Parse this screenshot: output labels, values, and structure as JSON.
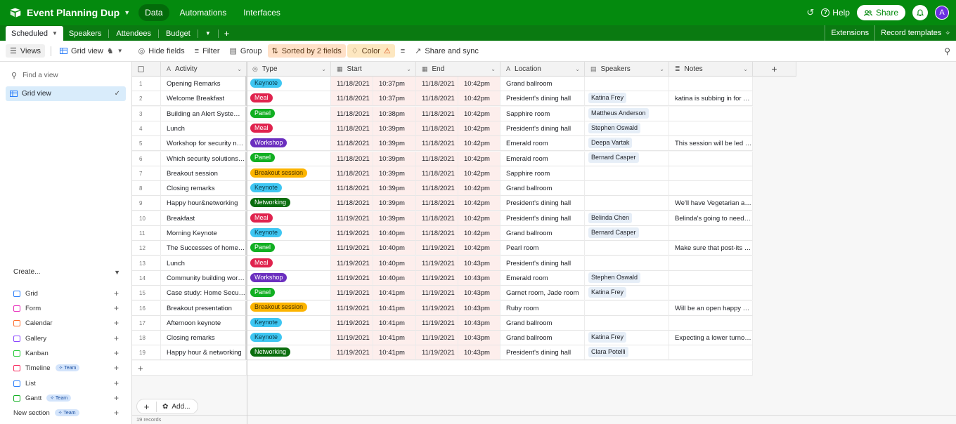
{
  "app": {
    "base_title": "Event Planning Dup",
    "nav": [
      "Data",
      "Automations",
      "Interfaces"
    ],
    "help": "Help",
    "share": "Share",
    "avatar_initial": "A",
    "accent": "#048a0e"
  },
  "tables": {
    "active": "Scheduled",
    "others": [
      "Speakers",
      "Attendees",
      "Budget"
    ],
    "extensions": "Extensions",
    "record_templates": "Record templates"
  },
  "viewbar": {
    "views": "Views",
    "grid_view": "Grid view",
    "hide_fields": "Hide fields",
    "filter": "Filter",
    "group": "Group",
    "sorted": "Sorted by 2 fields",
    "color": "Color",
    "share_sync": "Share and sync"
  },
  "sidebar": {
    "find_placeholder": "Find a view",
    "current_view": "Grid view",
    "create_label": "Create...",
    "create_items": [
      {
        "label": "Grid",
        "icon": "grid-icon",
        "color": "#2d7ff9",
        "team": ""
      },
      {
        "label": "Form",
        "icon": "form-icon",
        "color": "#e929ba",
        "team": ""
      },
      {
        "label": "Calendar",
        "icon": "calendar-icon",
        "color": "#ff6f2c",
        "team": ""
      },
      {
        "label": "Gallery",
        "icon": "gallery-icon",
        "color": "#8b46ff",
        "team": ""
      },
      {
        "label": "Kanban",
        "icon": "kanban-icon",
        "color": "#20c933",
        "team": ""
      },
      {
        "label": "Timeline",
        "icon": "timeline-icon",
        "color": "#f82b60",
        "team": "Team"
      },
      {
        "label": "List",
        "icon": "list-icon",
        "color": "#2d7ff9",
        "team": ""
      },
      {
        "label": "Gantt",
        "icon": "gantt-icon",
        "color": "#11af22",
        "team": "Team"
      },
      {
        "label": "New section",
        "icon": "",
        "color": "",
        "team": "Team"
      }
    ]
  },
  "grid": {
    "columns": [
      "Activity",
      "Type",
      "Start",
      "End",
      "Location",
      "Speakers",
      "Notes"
    ],
    "type_colors": {
      "Keynote": {
        "bg": "#3fc6f2",
        "fg": "#0b3a4a"
      },
      "Meal": {
        "bg": "#e0234e",
        "fg": "#ffffff"
      },
      "Panel": {
        "bg": "#11af22",
        "fg": "#ffffff"
      },
      "Workshop": {
        "bg": "#6b2fbf",
        "fg": "#ffffff"
      },
      "Breakout session": {
        "bg": "#fcb400",
        "fg": "#4a3200"
      },
      "Networking": {
        "bg": "#0b6e0f",
        "fg": "#ffffff"
      }
    },
    "rows": [
      {
        "n": "1",
        "activity": "Opening Remarks",
        "type": "Keynote",
        "start_date": "11/18/2021",
        "start_time": "10:37pm",
        "end_date": "11/18/2021",
        "end_time": "10:42pm",
        "location": "Grand ballroom",
        "speaker": "",
        "notes": ""
      },
      {
        "n": "2",
        "activity": "Welcome Breakfast",
        "type": "Meal",
        "start_date": "11/18/2021",
        "start_time": "10:37pm",
        "end_date": "11/18/2021",
        "end_time": "10:42pm",
        "location": "President's dining hall",
        "speaker": "Katina Frey",
        "notes": "katina is subbing in for Rus..."
      },
      {
        "n": "3",
        "activity": "Building an Alert System th...",
        "type": "Panel",
        "start_date": "11/18/2021",
        "start_time": "10:38pm",
        "end_date": "11/18/2021",
        "end_time": "10:42pm",
        "location": "Sapphire room",
        "speaker": "Mattheus Anderson",
        "notes": ""
      },
      {
        "n": "4",
        "activity": "Lunch",
        "type": "Meal",
        "start_date": "11/18/2021",
        "start_time": "10:39pm",
        "end_date": "11/18/2021",
        "end_time": "10:42pm",
        "location": "President's dining hall",
        "speaker": "Stephen Oswald",
        "notes": ""
      },
      {
        "n": "5",
        "activity": "Workshop for security noti...",
        "type": "Workshop",
        "start_date": "11/18/2021",
        "start_time": "10:39pm",
        "end_date": "11/18/2021",
        "end_time": "10:42pm",
        "location": "Emerald room",
        "speaker": "Deepa Vartak",
        "notes": "This session will be led by ..."
      },
      {
        "n": "6",
        "activity": "Which security solutions is ...",
        "type": "Panel",
        "start_date": "11/18/2021",
        "start_time": "10:39pm",
        "end_date": "11/18/2021",
        "end_time": "10:42pm",
        "location": "Emerald room",
        "speaker": "Bernard Casper",
        "notes": ""
      },
      {
        "n": "7",
        "activity": "Breakout session",
        "type": "Breakout session",
        "start_date": "11/18/2021",
        "start_time": "10:39pm",
        "end_date": "11/18/2021",
        "end_time": "10:42pm",
        "location": "Sapphire room",
        "speaker": "",
        "notes": ""
      },
      {
        "n": "8",
        "activity": "Closing remarks",
        "type": "Keynote",
        "start_date": "11/18/2021",
        "start_time": "10:39pm",
        "end_date": "11/18/2021",
        "end_time": "10:42pm",
        "location": "Grand ballroom",
        "speaker": "",
        "notes": ""
      },
      {
        "n": "9",
        "activity": "Happy hour&networking",
        "type": "Networking",
        "start_date": "11/18/2021",
        "start_time": "10:39pm",
        "end_date": "11/18/2021",
        "end_time": "10:42pm",
        "location": "President's dining hall",
        "speaker": "",
        "notes": "We'll have Vegetarian and ..."
      },
      {
        "n": "10",
        "activity": "Breakfast",
        "type": "Meal",
        "start_date": "11/19/2021",
        "start_time": "10:39pm",
        "end_date": "11/18/2021",
        "end_time": "10:42pm",
        "location": "President's dining hall",
        "speaker": "Belinda Chen",
        "notes": "Belinda's going to need a p..."
      },
      {
        "n": "11",
        "activity": "Morning Keynote",
        "type": "Keynote",
        "start_date": "11/19/2021",
        "start_time": "10:40pm",
        "end_date": "11/18/2021",
        "end_time": "10:42pm",
        "location": "Grand ballroom",
        "speaker": "Bernard Casper",
        "notes": ""
      },
      {
        "n": "12",
        "activity": "The Successes of home sec...",
        "type": "Panel",
        "start_date": "11/19/2021",
        "start_time": "10:40pm",
        "end_date": "11/19/2021",
        "end_time": "10:42pm",
        "location": "Pearl room",
        "speaker": "",
        "notes": "Make sure that post-its are..."
      },
      {
        "n": "13",
        "activity": "Lunch",
        "type": "Meal",
        "start_date": "11/19/2021",
        "start_time": "10:40pm",
        "end_date": "11/19/2021",
        "end_time": "10:43pm",
        "location": "President's dining hall",
        "speaker": "",
        "notes": ""
      },
      {
        "n": "14",
        "activity": "Community building works...",
        "type": "Workshop",
        "start_date": "11/19/2021",
        "start_time": "10:40pm",
        "end_date": "11/19/2021",
        "end_time": "10:43pm",
        "location": "Emerald room",
        "speaker": "Stephen Oswald",
        "notes": ""
      },
      {
        "n": "15",
        "activity": "Case study: Home SecurTech",
        "type": "Panel",
        "start_date": "11/19/2021",
        "start_time": "10:41pm",
        "end_date": "11/19/2021",
        "end_time": "10:43pm",
        "location": "Garnet room, Jade room",
        "speaker": "Katina Frey",
        "notes": ""
      },
      {
        "n": "16",
        "activity": "Breakout presentation",
        "type": "Breakout session",
        "start_date": "11/19/2021",
        "start_time": "10:41pm",
        "end_date": "11/19/2021",
        "end_time": "10:43pm",
        "location": "Ruby room",
        "speaker": "",
        "notes": "Will be an open happy hour"
      },
      {
        "n": "17",
        "activity": "Afternoon keynote",
        "type": "Keynote",
        "start_date": "11/19/2021",
        "start_time": "10:41pm",
        "end_date": "11/19/2021",
        "end_time": "10:43pm",
        "location": "Grand ballroom",
        "speaker": "",
        "notes": ""
      },
      {
        "n": "18",
        "activity": "Closing remarks",
        "type": "Keynote",
        "start_date": "11/19/2021",
        "start_time": "10:41pm",
        "end_date": "11/19/2021",
        "end_time": "10:43pm",
        "location": "Grand ballroom",
        "speaker": "Katina Frey",
        "notes": "Expecting a lower turnout ..."
      },
      {
        "n": "19",
        "activity": "Happy hour & networking",
        "type": "Networking",
        "start_date": "11/19/2021",
        "start_time": "10:41pm",
        "end_date": "11/19/2021",
        "end_time": "10:43pm",
        "location": "President's dining hall",
        "speaker": "Clara Potelli",
        "notes": ""
      }
    ],
    "add_label": "Add...",
    "record_count": "19 records"
  }
}
